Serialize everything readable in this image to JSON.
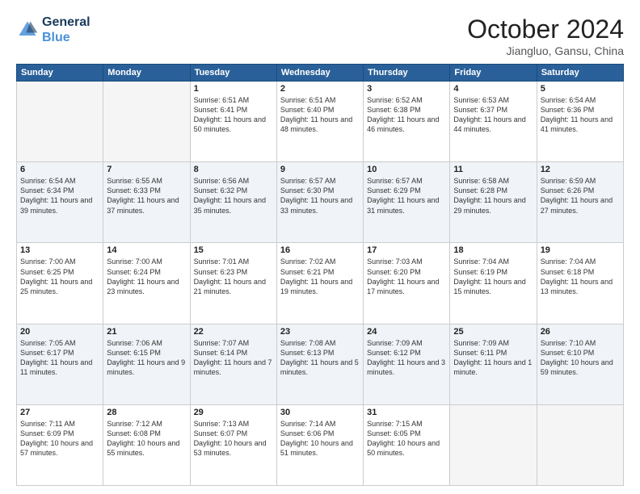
{
  "header": {
    "logo_line1": "General",
    "logo_line2": "Blue",
    "month_title": "October 2024",
    "location": "Jiangluo, Gansu, China"
  },
  "weekdays": [
    "Sunday",
    "Monday",
    "Tuesday",
    "Wednesday",
    "Thursday",
    "Friday",
    "Saturday"
  ],
  "weeks": [
    [
      {
        "day": "",
        "sunrise": "",
        "sunset": "",
        "daylight": "",
        "empty": true
      },
      {
        "day": "",
        "sunrise": "",
        "sunset": "",
        "daylight": "",
        "empty": true
      },
      {
        "day": "1",
        "sunrise": "Sunrise: 6:51 AM",
        "sunset": "Sunset: 6:41 PM",
        "daylight": "Daylight: 11 hours and 50 minutes."
      },
      {
        "day": "2",
        "sunrise": "Sunrise: 6:51 AM",
        "sunset": "Sunset: 6:40 PM",
        "daylight": "Daylight: 11 hours and 48 minutes."
      },
      {
        "day": "3",
        "sunrise": "Sunrise: 6:52 AM",
        "sunset": "Sunset: 6:38 PM",
        "daylight": "Daylight: 11 hours and 46 minutes."
      },
      {
        "day": "4",
        "sunrise": "Sunrise: 6:53 AM",
        "sunset": "Sunset: 6:37 PM",
        "daylight": "Daylight: 11 hours and 44 minutes."
      },
      {
        "day": "5",
        "sunrise": "Sunrise: 6:54 AM",
        "sunset": "Sunset: 6:36 PM",
        "daylight": "Daylight: 11 hours and 41 minutes."
      }
    ],
    [
      {
        "day": "6",
        "sunrise": "Sunrise: 6:54 AM",
        "sunset": "Sunset: 6:34 PM",
        "daylight": "Daylight: 11 hours and 39 minutes."
      },
      {
        "day": "7",
        "sunrise": "Sunrise: 6:55 AM",
        "sunset": "Sunset: 6:33 PM",
        "daylight": "Daylight: 11 hours and 37 minutes."
      },
      {
        "day": "8",
        "sunrise": "Sunrise: 6:56 AM",
        "sunset": "Sunset: 6:32 PM",
        "daylight": "Daylight: 11 hours and 35 minutes."
      },
      {
        "day": "9",
        "sunrise": "Sunrise: 6:57 AM",
        "sunset": "Sunset: 6:30 PM",
        "daylight": "Daylight: 11 hours and 33 minutes."
      },
      {
        "day": "10",
        "sunrise": "Sunrise: 6:57 AM",
        "sunset": "Sunset: 6:29 PM",
        "daylight": "Daylight: 11 hours and 31 minutes."
      },
      {
        "day": "11",
        "sunrise": "Sunrise: 6:58 AM",
        "sunset": "Sunset: 6:28 PM",
        "daylight": "Daylight: 11 hours and 29 minutes."
      },
      {
        "day": "12",
        "sunrise": "Sunrise: 6:59 AM",
        "sunset": "Sunset: 6:26 PM",
        "daylight": "Daylight: 11 hours and 27 minutes."
      }
    ],
    [
      {
        "day": "13",
        "sunrise": "Sunrise: 7:00 AM",
        "sunset": "Sunset: 6:25 PM",
        "daylight": "Daylight: 11 hours and 25 minutes."
      },
      {
        "day": "14",
        "sunrise": "Sunrise: 7:00 AM",
        "sunset": "Sunset: 6:24 PM",
        "daylight": "Daylight: 11 hours and 23 minutes."
      },
      {
        "day": "15",
        "sunrise": "Sunrise: 7:01 AM",
        "sunset": "Sunset: 6:23 PM",
        "daylight": "Daylight: 11 hours and 21 minutes."
      },
      {
        "day": "16",
        "sunrise": "Sunrise: 7:02 AM",
        "sunset": "Sunset: 6:21 PM",
        "daylight": "Daylight: 11 hours and 19 minutes."
      },
      {
        "day": "17",
        "sunrise": "Sunrise: 7:03 AM",
        "sunset": "Sunset: 6:20 PM",
        "daylight": "Daylight: 11 hours and 17 minutes."
      },
      {
        "day": "18",
        "sunrise": "Sunrise: 7:04 AM",
        "sunset": "Sunset: 6:19 PM",
        "daylight": "Daylight: 11 hours and 15 minutes."
      },
      {
        "day": "19",
        "sunrise": "Sunrise: 7:04 AM",
        "sunset": "Sunset: 6:18 PM",
        "daylight": "Daylight: 11 hours and 13 minutes."
      }
    ],
    [
      {
        "day": "20",
        "sunrise": "Sunrise: 7:05 AM",
        "sunset": "Sunset: 6:17 PM",
        "daylight": "Daylight: 11 hours and 11 minutes."
      },
      {
        "day": "21",
        "sunrise": "Sunrise: 7:06 AM",
        "sunset": "Sunset: 6:15 PM",
        "daylight": "Daylight: 11 hours and 9 minutes."
      },
      {
        "day": "22",
        "sunrise": "Sunrise: 7:07 AM",
        "sunset": "Sunset: 6:14 PM",
        "daylight": "Daylight: 11 hours and 7 minutes."
      },
      {
        "day": "23",
        "sunrise": "Sunrise: 7:08 AM",
        "sunset": "Sunset: 6:13 PM",
        "daylight": "Daylight: 11 hours and 5 minutes."
      },
      {
        "day": "24",
        "sunrise": "Sunrise: 7:09 AM",
        "sunset": "Sunset: 6:12 PM",
        "daylight": "Daylight: 11 hours and 3 minutes."
      },
      {
        "day": "25",
        "sunrise": "Sunrise: 7:09 AM",
        "sunset": "Sunset: 6:11 PM",
        "daylight": "Daylight: 11 hours and 1 minute."
      },
      {
        "day": "26",
        "sunrise": "Sunrise: 7:10 AM",
        "sunset": "Sunset: 6:10 PM",
        "daylight": "Daylight: 10 hours and 59 minutes."
      }
    ],
    [
      {
        "day": "27",
        "sunrise": "Sunrise: 7:11 AM",
        "sunset": "Sunset: 6:09 PM",
        "daylight": "Daylight: 10 hours and 57 minutes."
      },
      {
        "day": "28",
        "sunrise": "Sunrise: 7:12 AM",
        "sunset": "Sunset: 6:08 PM",
        "daylight": "Daylight: 10 hours and 55 minutes."
      },
      {
        "day": "29",
        "sunrise": "Sunrise: 7:13 AM",
        "sunset": "Sunset: 6:07 PM",
        "daylight": "Daylight: 10 hours and 53 minutes."
      },
      {
        "day": "30",
        "sunrise": "Sunrise: 7:14 AM",
        "sunset": "Sunset: 6:06 PM",
        "daylight": "Daylight: 10 hours and 51 minutes."
      },
      {
        "day": "31",
        "sunrise": "Sunrise: 7:15 AM",
        "sunset": "Sunset: 6:05 PM",
        "daylight": "Daylight: 10 hours and 50 minutes."
      },
      {
        "day": "",
        "sunrise": "",
        "sunset": "",
        "daylight": "",
        "empty": true
      },
      {
        "day": "",
        "sunrise": "",
        "sunset": "",
        "daylight": "",
        "empty": true
      }
    ]
  ]
}
